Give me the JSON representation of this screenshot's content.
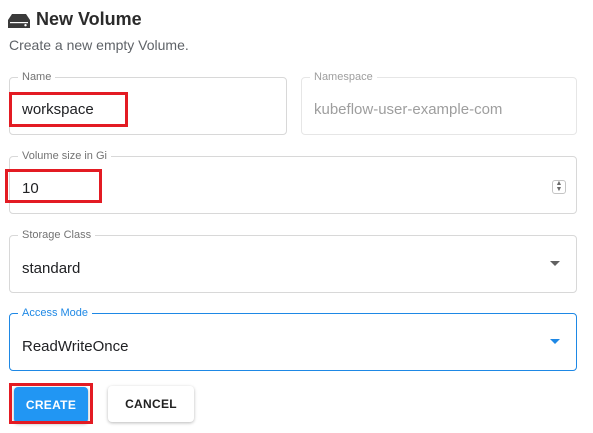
{
  "header": {
    "icon": "storage-drive-icon",
    "title": "New Volume",
    "subtitle": "Create a new empty Volume."
  },
  "form": {
    "name": {
      "label": "Name",
      "value": "workspace"
    },
    "namespace": {
      "label": "Namespace",
      "value": "kubeflow-user-example-com"
    },
    "size": {
      "label": "Volume size in Gi",
      "value": "10"
    },
    "storage_class": {
      "label": "Storage Class",
      "value": "standard"
    },
    "access_mode": {
      "label": "Access Mode",
      "value": "ReadWriteOnce"
    }
  },
  "buttons": {
    "create": "CREATE",
    "cancel": "CANCEL"
  },
  "colors": {
    "accent": "#1e88e5",
    "create_button": "#2196f3",
    "highlight": "#e31b23"
  }
}
